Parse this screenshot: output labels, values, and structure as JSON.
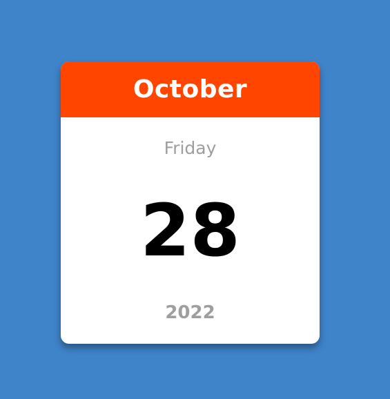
{
  "calendar": {
    "month": "October",
    "weekday": "Friday",
    "day": "28",
    "year": "2022"
  },
  "colors": {
    "background": "#3f83c9",
    "header": "#ff4500",
    "card": "#ffffff",
    "muted_text": "#9e9e9e",
    "day_text": "#000000"
  }
}
